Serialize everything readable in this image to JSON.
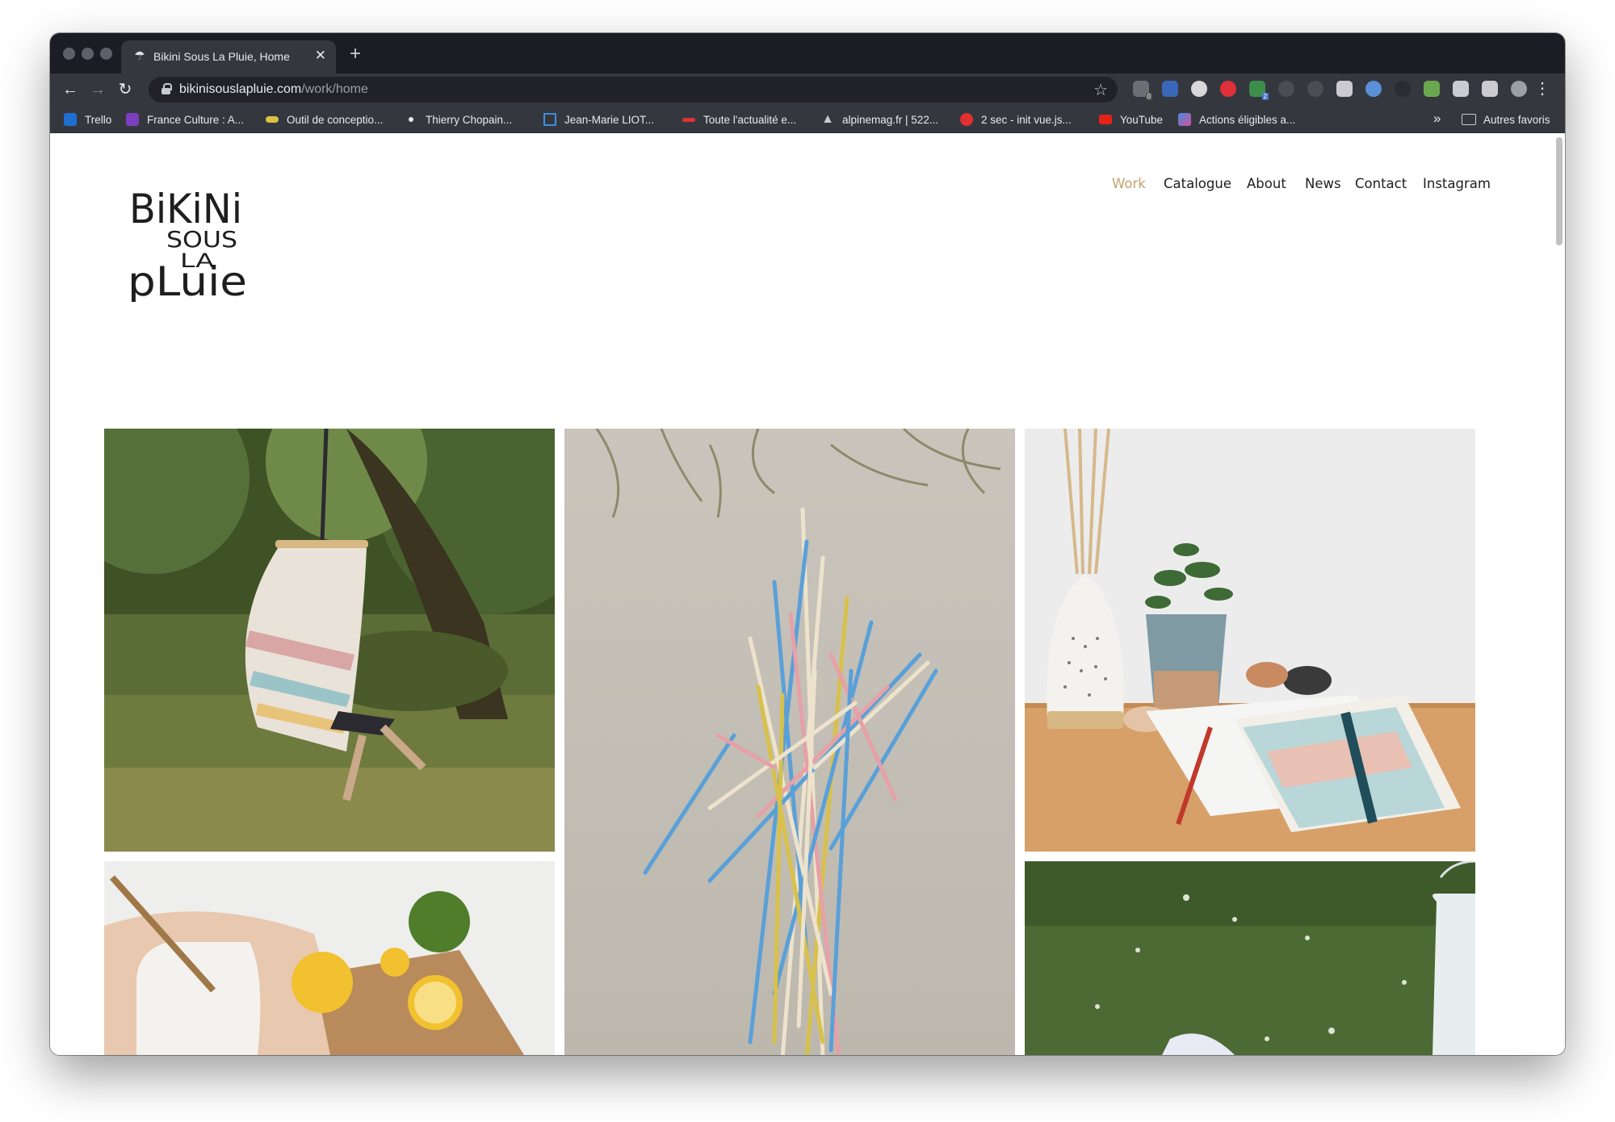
{
  "browser": {
    "tab": {
      "title": "Bikini Sous La Pluie, Home"
    },
    "address": {
      "domain": "bikinisouslapluie.com",
      "path": "/work/home"
    },
    "bookmarks": [
      {
        "label": "Trello",
        "color": "#1f6fd1"
      },
      {
        "label": "France Culture : A...",
        "color": "#7a3fbf"
      },
      {
        "label": "Outil de conceptio...",
        "color": "#d9c244"
      },
      {
        "label": "Thierry Chopain...",
        "color": "#e8eaed"
      },
      {
        "label": "Jean-Marie LIOT...",
        "color": "#3e8ede"
      },
      {
        "label": "Toute l'actualité e...",
        "color": "#e0303a"
      },
      {
        "label": "alpinemag.fr | 522...",
        "color": "#c9cbd0"
      },
      {
        "label": "2 sec - init vue.js...",
        "color": "#e03030"
      },
      {
        "label": "YouTube",
        "color": "#e62117"
      },
      {
        "label": "Actions éligibles a...",
        "color": "#d84fa0"
      }
    ],
    "more_label": "»",
    "other_bookmarks": "Autres favoris"
  },
  "site": {
    "logo": {
      "line1": "BiKiNi",
      "line2": "SOUS",
      "line3": "LA",
      "line4": "pLuie"
    },
    "nav": [
      {
        "label": "Work",
        "active": true
      },
      {
        "label": "Catalogue",
        "active": false
      },
      {
        "label": "About",
        "active": false
      },
      {
        "label": "News",
        "active": false
      },
      {
        "label": "Contact",
        "active": false
      },
      {
        "label": "Instagram",
        "active": false
      }
    ],
    "accent_color": "#c3a16a"
  },
  "gallery": [
    {
      "subject": "hammock-chair-in-garden"
    },
    {
      "subject": "mikado-sticks-on-sand"
    },
    {
      "subject": "diffuser-plant-notebook"
    },
    {
      "subject": "pitcher-lemons-board"
    },
    {
      "subject": "lantern-on-grass"
    }
  ]
}
